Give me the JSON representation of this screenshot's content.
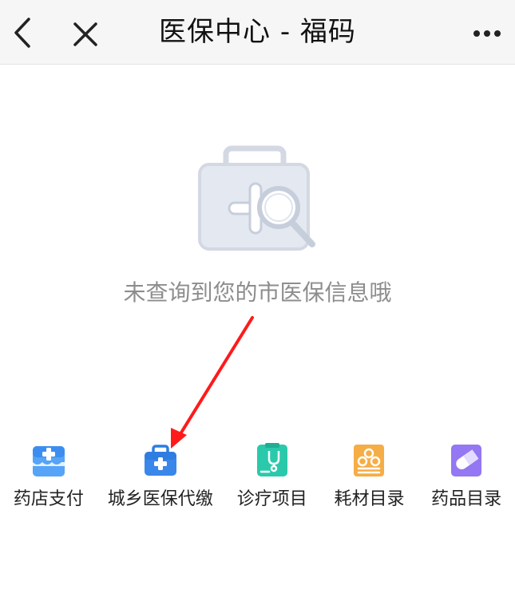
{
  "navbar": {
    "title": "医保中心 - 福码",
    "back_icon": "chevron-left-icon",
    "close_icon": "close-icon",
    "more_icon": "more-dots-icon"
  },
  "empty_state": {
    "illustration": "medical-kit-search-icon",
    "message": "未查询到您的市医保信息哦"
  },
  "annotation": {
    "type": "red-arrow",
    "color": "#ff1a1a",
    "points_to": "城乡医保代缴"
  },
  "services": [
    {
      "label": "药店支付",
      "icon": "pharmacy-store-icon",
      "color": "#3b8ef0"
    },
    {
      "label": "城乡医保代缴",
      "icon": "medical-kit-icon",
      "color": "#2f7de0"
    },
    {
      "label": "诊疗项目",
      "icon": "stethoscope-icon",
      "color": "#22c3a6"
    },
    {
      "label": "耗材目录",
      "icon": "materials-catalog-icon",
      "color": "#f2a43a"
    },
    {
      "label": "药品目录",
      "icon": "pill-icon",
      "color": "#8e6ef0"
    }
  ]
}
